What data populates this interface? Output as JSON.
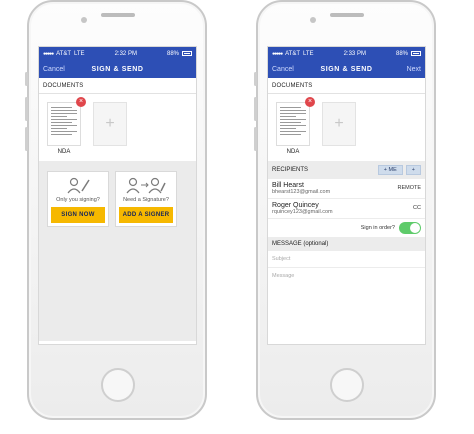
{
  "left_phone": {
    "status": {
      "carrier": "AT&T",
      "network": "LTE",
      "time": "2:32 PM",
      "battery": "88%"
    },
    "nav": {
      "left": "Cancel",
      "title": "SIGN & SEND",
      "right": ""
    },
    "documents_label": "DOCUMENTS",
    "documents": [
      {
        "name": "NDA"
      }
    ],
    "choices": [
      {
        "text": "Only you signing?",
        "button": "SIGN NOW",
        "icon": "single-signer-icon"
      },
      {
        "text": "Need a Signature?",
        "button": "ADD A SIGNER",
        "icon": "add-signer-icon"
      }
    ]
  },
  "right_phone": {
    "status": {
      "carrier": "AT&T",
      "network": "LTE",
      "time": "2:33 PM",
      "battery": "88%"
    },
    "nav": {
      "left": "Cancel",
      "title": "SIGN & SEND",
      "right": "Next"
    },
    "documents_label": "DOCUMENTS",
    "documents": [
      {
        "name": "NDA"
      }
    ],
    "recipients_label": "RECIPIENTS",
    "recipient_buttons": {
      "me": "+ ME",
      "add": "+"
    },
    "recipients": [
      {
        "name": "Bill Hearst",
        "email": "bhearst123@gmail.com",
        "type": "REMOTE"
      },
      {
        "name": "Roger Quincey",
        "email": "rquincey123@gmail.com",
        "type": "CC"
      }
    ],
    "sign_in_order_label": "Sign in order?",
    "message_label": "MESSAGE (optional)",
    "subject_placeholder": "Subject",
    "message_placeholder": "Message"
  },
  "colors": {
    "brand": "#2d4fb5",
    "cta": "#f6b800",
    "remove": "#e0464b",
    "toggle_on": "#5ecb6a"
  }
}
